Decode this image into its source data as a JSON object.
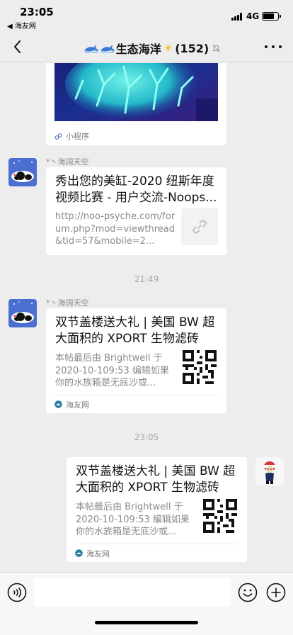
{
  "status_bar": {
    "time": "23:05",
    "back_app": "◀ 海友网",
    "network": "4G"
  },
  "nav": {
    "title": "生态海洋",
    "member_count": "(152)"
  },
  "messages": {
    "first_card": {
      "footer": "小程序"
    },
    "second": {
      "sender": "*丶海阔天空",
      "title": "秀出您的美缸-2020 纽斯年度视频比赛 - 用户交流-Noops...",
      "desc": "http://noo-psyche.com/forum.php?mod=viewthread&tid=57&mobile=2..."
    },
    "timestamp_1": "21:49",
    "third": {
      "sender": "*丶海阔天空",
      "title": "双节盖楼送大礼 | 美国 BW 超大面积的 XPORT 生物滤砖等...",
      "desc": "本帖最后由 Brightwell 于 2020-10-109:53 编辑如果你的水族箱是无底沙或...",
      "footer": "海友网"
    },
    "timestamp_2": "23:05",
    "fourth": {
      "title": "双节盖楼送大礼 | 美国 BW 超大面积的 XPORT 生物滤砖等...",
      "desc": "本帖最后由 Brightwell 于 2020-10-109:53 编辑如果你的水族箱是无底沙或...",
      "footer": "海友网"
    }
  },
  "icons": [
    "back-icon",
    "more-icon",
    "mute-icon",
    "link-icon",
    "voice-icon",
    "emoji-icon",
    "plus-icon",
    "mini-program-icon",
    "site-logo-icon"
  ],
  "colors": {
    "background": "#ededed",
    "card": "#ffffff",
    "link_preview_bg": "#f2f2f2"
  }
}
